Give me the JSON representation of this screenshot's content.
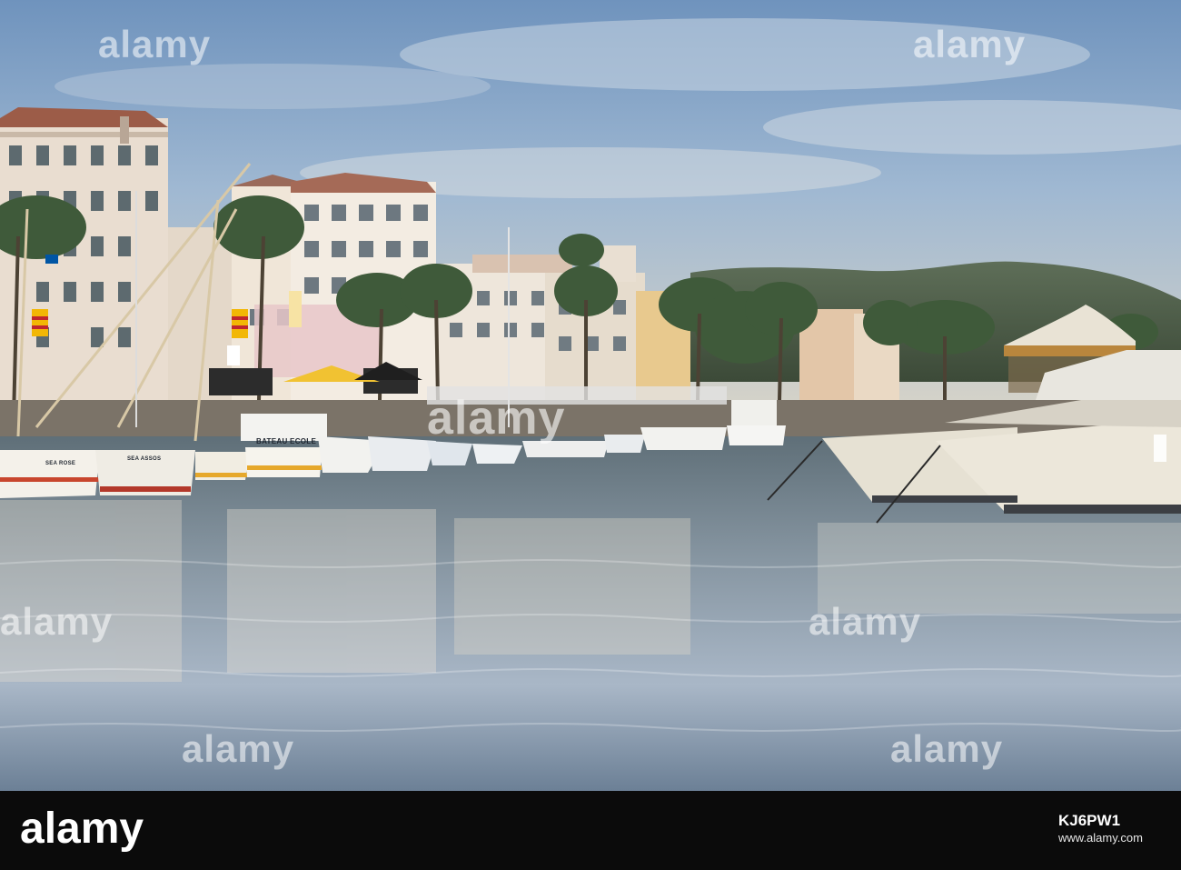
{
  "photo": {
    "description_alt": "Harbour with moored boats and waterfront buildings",
    "boat_labels": {
      "ecole": "BATEAU ECOLE",
      "sea1": "SEA ROSE",
      "sea2": "SEA ASSOS"
    },
    "watermark": "alamy"
  },
  "footer": {
    "logo": "alamy",
    "stock_id": "KJ6PW1",
    "site": "www.alamy.com"
  }
}
